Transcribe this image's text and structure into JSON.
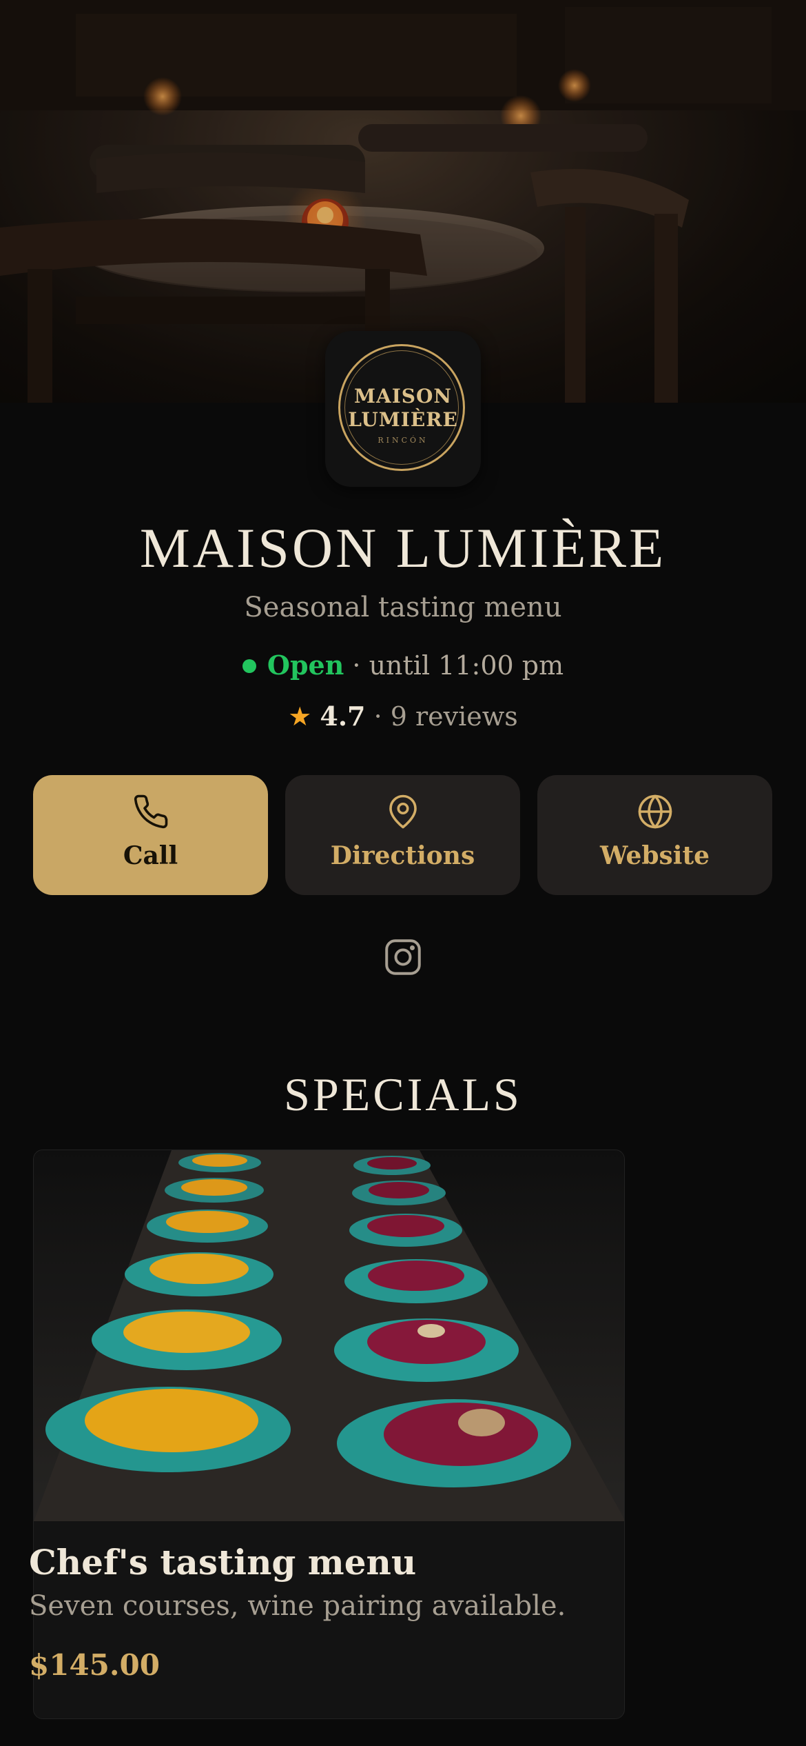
{
  "restaurant": {
    "logo_line1": "MAISON",
    "logo_line2": "LUMIÈRE",
    "logo_sub": "RINCÓN",
    "name": "MAISON LUMIÈRE",
    "tagline": "Seasonal tasting menu",
    "status_open": "Open",
    "status_hours": " · until 11:00 pm",
    "rating_star": "★",
    "rating_value": "4.7",
    "rating_reviews": " · 9 reviews"
  },
  "actions": {
    "call": "Call",
    "directions": "Directions",
    "website": "Website"
  },
  "icons": {
    "call": "phone-icon",
    "directions": "map-pin-icon",
    "website": "globe-icon",
    "social": "instagram-icon"
  },
  "specials": {
    "heading": "SPECIALS",
    "items": [
      {
        "title": "Chef's tasting menu",
        "description": "Seven courses, wine pairing available.",
        "price": "$145.00"
      }
    ]
  },
  "colors": {
    "background": "#0a0a0a",
    "accent_gold": "#c9a765",
    "open_green": "#22c55e",
    "star_amber": "#f5a524"
  }
}
